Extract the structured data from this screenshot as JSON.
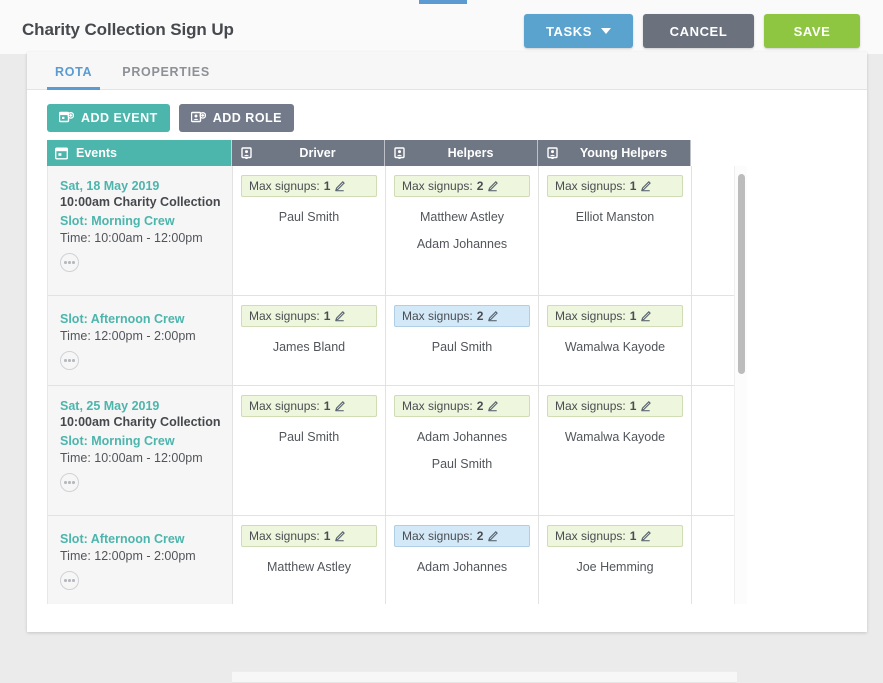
{
  "header": {
    "title": "Charity Collection Sign Up",
    "buttons": {
      "tasks": "TASKS",
      "cancel": "CANCEL",
      "save": "SAVE"
    }
  },
  "tabs": [
    {
      "label": "ROTA",
      "active": true
    },
    {
      "label": "PROPERTIES",
      "active": false
    }
  ],
  "actions": {
    "add_event": "ADD EVENT",
    "add_role": "ADD ROLE"
  },
  "columns": [
    {
      "label": "Events",
      "icon": "calendar-icon",
      "color": "#4cb5ac"
    },
    {
      "label": "Driver",
      "icon": "person-card-icon",
      "color": "#6f7785"
    },
    {
      "label": "Helpers",
      "icon": "person-card-icon",
      "color": "#6f7785"
    },
    {
      "label": "Young Helpers",
      "icon": "person-card-icon",
      "color": "#6f7785"
    }
  ],
  "max_signups_label": "Max signups:",
  "rows": [
    {
      "date": "Sat, 18 May 2019",
      "event_name": "10:00am Charity Collection",
      "slot": "Slot: Morning Crew",
      "time": "Time: 10:00am - 12:00pm",
      "cells": [
        {
          "max": "1",
          "selected": false,
          "signups": [
            "Paul Smith"
          ]
        },
        {
          "max": "2",
          "selected": false,
          "signups": [
            "Matthew Astley",
            "Adam Johannes"
          ]
        },
        {
          "max": "1",
          "selected": false,
          "signups": [
            "Elliot Manston"
          ]
        }
      ]
    },
    {
      "date": "",
      "event_name": "",
      "slot": "Slot: Afternoon Crew",
      "time": "Time: 12:00pm - 2:00pm",
      "cells": [
        {
          "max": "1",
          "selected": false,
          "signups": [
            "James Bland"
          ]
        },
        {
          "max": "2",
          "selected": true,
          "signups": [
            "Paul Smith"
          ]
        },
        {
          "max": "1",
          "selected": false,
          "signups": [
            "Wamalwa Kayode"
          ]
        }
      ]
    },
    {
      "date": "Sat, 25 May 2019",
      "event_name": "10:00am Charity Collection",
      "slot": "Slot: Morning Crew",
      "time": "Time: 10:00am - 12:00pm",
      "cells": [
        {
          "max": "1",
          "selected": false,
          "signups": [
            "Paul Smith"
          ]
        },
        {
          "max": "2",
          "selected": false,
          "signups": [
            "Adam Johannes",
            "Paul Smith"
          ]
        },
        {
          "max": "1",
          "selected": false,
          "signups": [
            "Wamalwa Kayode"
          ]
        }
      ]
    },
    {
      "date": "",
      "event_name": "",
      "slot": "Slot: Afternoon Crew",
      "time": "Time: 12:00pm - 2:00pm",
      "cells": [
        {
          "max": "1",
          "selected": false,
          "signups": [
            "Matthew Astley"
          ]
        },
        {
          "max": "2",
          "selected": true,
          "signups": [
            "Adam Johannes"
          ]
        },
        {
          "max": "1",
          "selected": false,
          "signups": [
            "Joe Hemming"
          ]
        }
      ]
    }
  ],
  "colors": {
    "teal": "#4cb5ac",
    "slate": "#6f7785",
    "blue": "#5b9bd1",
    "green": "#8ec641",
    "badge_green_bg": "#eef6dd",
    "badge_blue_bg": "#d4e9f7"
  }
}
